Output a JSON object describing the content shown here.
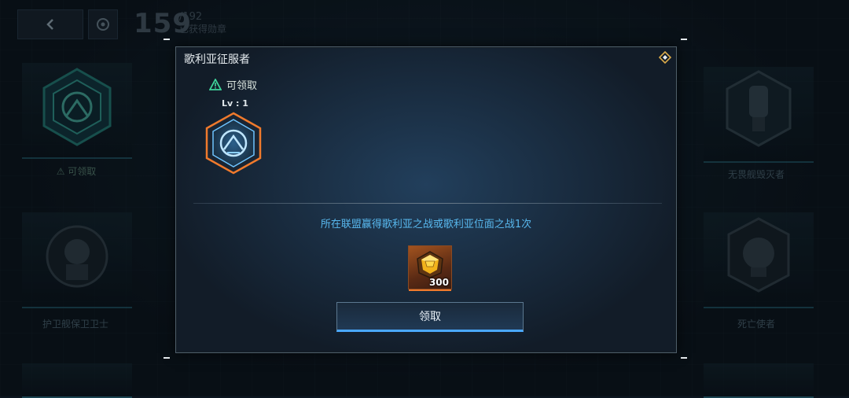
{
  "header": {
    "back_icon": "chevron-left-icon",
    "target_icon": "crosshair-icon",
    "count": "159",
    "total": "/192",
    "count_label": "已获得勋章"
  },
  "background": {
    "labels": {
      "claim_status": "可领取",
      "dreadnought_destroyer": "无畏舰毁灭者",
      "escort_guard": "护卫舰保卫卫士",
      "death_messenger": "死亡使者"
    }
  },
  "modal": {
    "title": "歌利亚征服者",
    "corner_icon": "diamond-icon",
    "claim_status": "可领取",
    "level": "Lv : 1",
    "description": "所在联盟赢得歌利亚之战或歌利亚位面之战1次",
    "reward": {
      "icon": "gem-crate-icon",
      "quantity": "300"
    },
    "claim_button": "领取"
  },
  "colors": {
    "accent_blue": "#4aa8ff",
    "desc_text": "#58b8ee",
    "badge_orange": "#f07a2c",
    "claim_green": "#3fd39a"
  }
}
